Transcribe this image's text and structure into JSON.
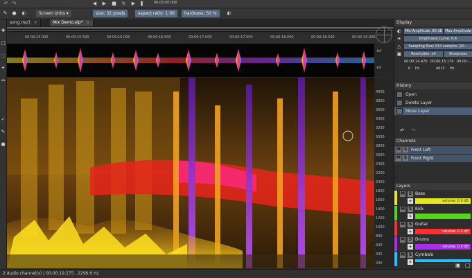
{
  "app": {
    "time_display": "00:00:00.000",
    "icons": [
      "undo-icon",
      "redo-icon",
      "play-icon",
      "stop-icon",
      "record-icon",
      "loop-icon",
      "rewind-icon",
      "forward-icon",
      "pause-icon"
    ]
  },
  "tool_options": {
    "units": "Screen Units",
    "size": "size: 32 pixels",
    "aspect": "aspect ratio: 1.00",
    "hardness": "hardness: 50 %"
  },
  "tabs": [
    {
      "label": "song.mp3"
    },
    {
      "label": "Mix Demo.slp*"
    }
  ],
  "ruler": [
    "00:00:15.000",
    "00:00:15.500",
    "00:00:16.000",
    "00:00:16.500",
    "00:00:17.000",
    "00:00:17.500",
    "00:00:18.000",
    "00:00:18.500",
    "00:00:19.000"
  ],
  "wave_axis": [
    "-Inf",
    "-Inf"
  ],
  "freq_axis": [
    "4000",
    "3800",
    "3600",
    "3400",
    "3200",
    "3000",
    "2800",
    "2600",
    "2400",
    "2200",
    "2000",
    "1800",
    "1600",
    "1400",
    "1200",
    "1000",
    "800",
    "600",
    "400",
    "200"
  ],
  "display": {
    "title": "Display",
    "min_amp": "Min Amplitude: 90 dB",
    "max_amp": "Max Amplitude",
    "brightness": "Brightness Curve: 0.4",
    "sampling": "Sampling Size: 512 samples (10...",
    "resolution": "Resolution: x4",
    "sharpness": "Sharpness",
    "time1": "00:00:14.470",
    "time2": "00:00:15.170",
    "time3": "00:00:...",
    "hz1": "0",
    "hz_unit1": "Hz",
    "hz2": "4013",
    "hz_unit2": "Hz"
  },
  "history": {
    "title": "History",
    "items": [
      {
        "label": "Open"
      },
      {
        "label": "Delete Layer"
      },
      {
        "label": "Move Layer"
      }
    ]
  },
  "channels": {
    "title": "Channels",
    "items": [
      {
        "label": "Front Left"
      },
      {
        "label": "Front Right"
      }
    ]
  },
  "layers": {
    "title": "Layers",
    "items": [
      {
        "name": "Bass",
        "volume": "volume: 0.0 dB",
        "color": "#e6e61a"
      },
      {
        "name": "Kick",
        "volume": "",
        "color": "#58d31c"
      },
      {
        "name": "Guitar",
        "volume": "volume: 0.0 dB",
        "color": "#ff2d2d"
      },
      {
        "name": "Drums",
        "volume": "volume: 0.0 dB",
        "color": "#a92cf0"
      },
      {
        "name": "Cymbals",
        "volume": "",
        "color": "#20c0ff"
      }
    ]
  },
  "status": "2 Audio channel(s) | 00:00:19.275 , 2296.6 Hz"
}
